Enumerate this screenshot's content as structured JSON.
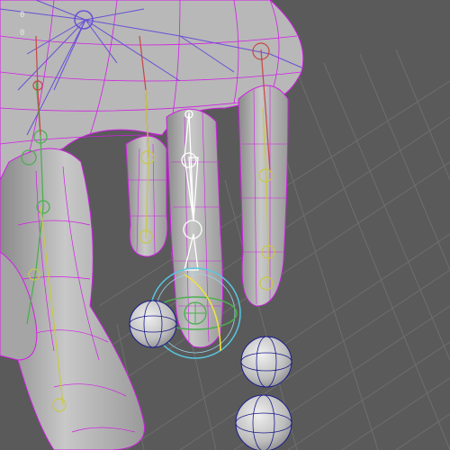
{
  "viewport": {
    "hud_values": [
      "0",
      "0"
    ]
  },
  "colors": {
    "background": "#5a5a5a",
    "grid_line": "#6e6e6e",
    "mesh_fill": "#b4b4b4",
    "wireframe": "#d21ee6",
    "joint_white": "#ffffff",
    "joint_green": "#4caf50",
    "joint_yellow": "#c8c846",
    "joint_red": "#c84646",
    "ik_purple": "#6a4fd6",
    "manipulator_cyan": "#56c8e0",
    "manipulator_yellow": "#f0e040",
    "sphere_fill": "#d0d0d0",
    "sphere_wire": "#1a1a8c"
  },
  "icons": {
    "selected_control": "rotate-manipulator-icon",
    "joint": "joint-chain-icon",
    "ball": "wire-sphere-icon"
  }
}
